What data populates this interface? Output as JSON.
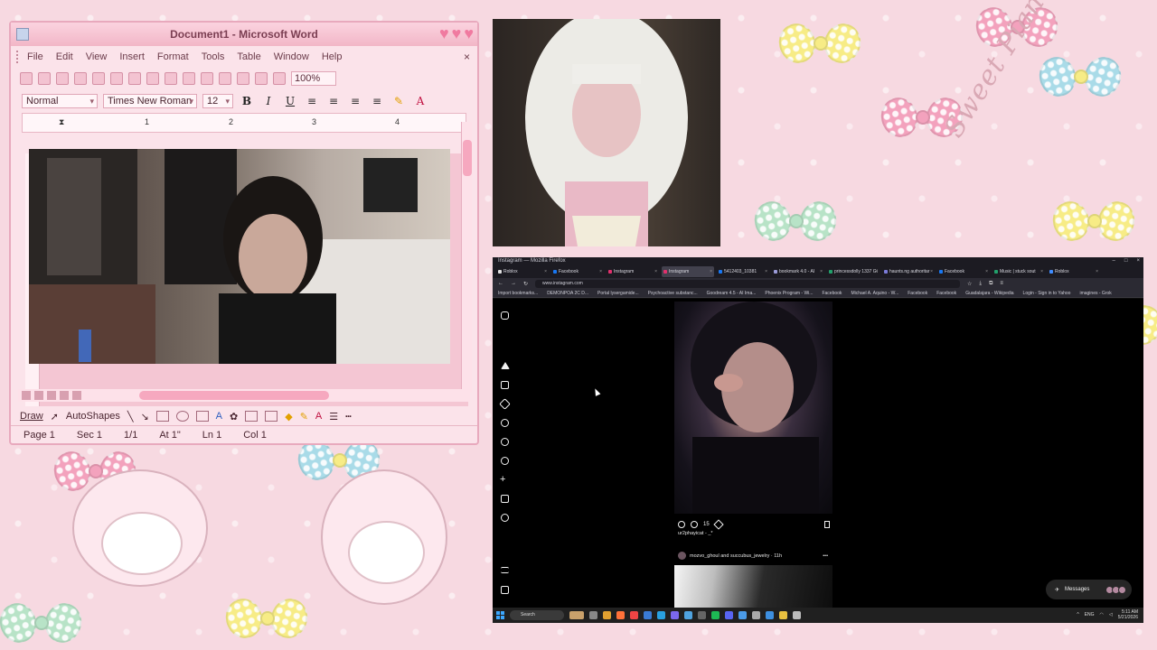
{
  "background": {
    "theme": "my-melody-pink-wallpaper",
    "script_text": "Sweet Piano",
    "colors": {
      "base": "#f7d9e1",
      "bow_yellow": "#f7ec86",
      "bow_blue": "#a9dbe8",
      "bow_pink": "#f3a2bd",
      "bow_green": "#b8e3c7"
    }
  },
  "word": {
    "window_title": "Document1 - Microsoft Word",
    "menu": [
      "File",
      "Edit",
      "View",
      "Insert",
      "Format",
      "Tools",
      "Table",
      "Window",
      "Help"
    ],
    "close_doc": "×",
    "zoom": "100%",
    "style": "Normal",
    "font": "Times New Roman",
    "font_size": "12",
    "bold": "B",
    "italic": "I",
    "underline": "U",
    "ruler_marks": [
      "1",
      "2",
      "3",
      "4"
    ],
    "draw_label": "Draw",
    "autoshapes_label": "AutoShapes",
    "status": {
      "page": "Page 1",
      "section": "Sec 1",
      "pages": "1/1",
      "at": "At 1\"",
      "line": "Ln 1",
      "col": "Col 1"
    },
    "accent": "#f07aa0"
  },
  "firefox": {
    "window_title": "Instagram — Mozilla Firefox",
    "tabs": [
      {
        "label": "Roblox",
        "fav": "#e0e0e0"
      },
      {
        "label": "Facebook",
        "fav": "#1877f2"
      },
      {
        "label": "Instagram",
        "fav": "#e1306c"
      },
      {
        "label": "Instagram",
        "fav": "#e1306c",
        "active": true
      },
      {
        "label": "5412403_10381",
        "fav": "#1877f2"
      },
      {
        "label": "bookmark 4.0 - AI",
        "fav": "#9b9bd8"
      },
      {
        "label": "princessdolly 1337 Gi",
        "fav": "#22a06b"
      },
      {
        "label": "haunts.ng authoritar",
        "fav": "#7b7bd8"
      },
      {
        "label": "Facebook",
        "fav": "#1877f2"
      },
      {
        "label": "Music | stuck sout",
        "fav": "#22a06b"
      },
      {
        "label": "Roblox",
        "fav": "#3f8cff"
      }
    ],
    "url": "www.instagram.com",
    "bookmarks": [
      "Import bookmarks...",
      "DEMONPOA 2C D...",
      "Portal lysergamide...",
      "Psychoactive substanc...",
      "Goodream 4.5 - AI Ima...",
      "Phoenix Program - Wi...",
      "Facebook",
      "Michael A. Aquino - W...",
      "Facebook",
      "Facebook",
      "Guadalajara - Wikipedia",
      "Login - Sign in to Yahoo",
      "imagines - Grok"
    ]
  },
  "instagram": {
    "caption": "ur2phayicat - _*",
    "comment_count": "15",
    "next_post_author": "mozvo_ghoul and succubus_jewelry · 11h",
    "messages_label": "Messages",
    "sidebar_icons": [
      "instagram-logo-icon",
      "home-icon",
      "reels-icon",
      "send-icon",
      "search-icon",
      "explore-icon",
      "heart-icon",
      "create-icon",
      "dashboard-icon",
      "threads-icon",
      "menu-icon",
      "also-from-meta-icon"
    ]
  },
  "taskbar": {
    "search_label": "Search",
    "lang": "ENG",
    "time": "5:11 AM",
    "date": "5/21/2026"
  }
}
